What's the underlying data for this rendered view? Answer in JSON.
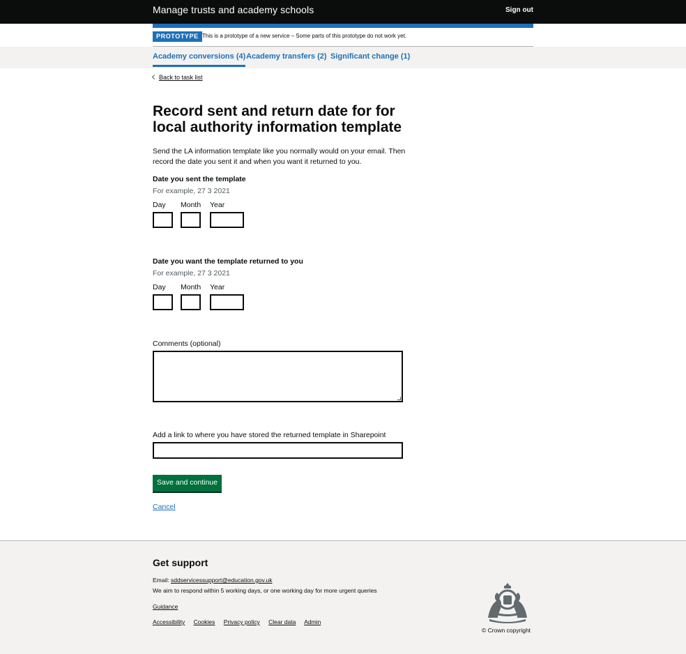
{
  "header": {
    "service_name": "Manage trusts and academy schools",
    "sign_out": "Sign out"
  },
  "phase_banner": {
    "tag": "PROTOTYPE",
    "text": "This is a prototype of a new service – Some parts of this prototype do not work yet."
  },
  "subnav": {
    "tabs": [
      {
        "label": "Academy conversions (4)",
        "active": true
      },
      {
        "label": "Academy transfers (2)",
        "active": false
      },
      {
        "label": "Significant change (1)",
        "active": false
      }
    ]
  },
  "back_link": "Back to task list",
  "page_title": "Record sent and return date for for local authority information template",
  "intro": "Send the LA information template like you normally would on your email. Then record the date you sent it and when you want it returned to you.",
  "sent_date": {
    "legend": "Date you sent the template",
    "hint": "For example, 27 3 2021",
    "day_label": "Day",
    "month_label": "Month",
    "year_label": "Year",
    "day_value": "",
    "month_value": "",
    "year_value": ""
  },
  "return_date": {
    "legend": "Date you want the template returned to you",
    "hint": "For example, 27 3 2021",
    "day_label": "Day",
    "month_label": "Month",
    "year_label": "Year",
    "day_value": "",
    "month_value": "",
    "year_value": ""
  },
  "comments": {
    "label": "Comments (optional)",
    "value": ""
  },
  "sharepoint_link": {
    "label": "Add a link to where you have stored the returned template in Sharepoint",
    "value": ""
  },
  "actions": {
    "save_label": "Save and continue",
    "cancel_label": "Cancel"
  },
  "footer": {
    "heading": "Get support",
    "email_prefix": "Email: ",
    "email": "sddservicessupport@education.gov.uk",
    "respond_text": "We aim to respond within 5 working days, or one working day for more urgent queries",
    "guidance": "Guidance",
    "links": [
      "Accessibility",
      "Cookies",
      "Privacy policy",
      "Clear data",
      "Admin"
    ],
    "copyright": "© Crown copyright",
    "crest_icon": "royal-coat-of-arms-icon"
  },
  "colors": {
    "header_bg": "#0b0c0c",
    "brand_blue": "#1d70b8",
    "button_green": "#00703c",
    "footer_bg": "#f3f2f1"
  }
}
